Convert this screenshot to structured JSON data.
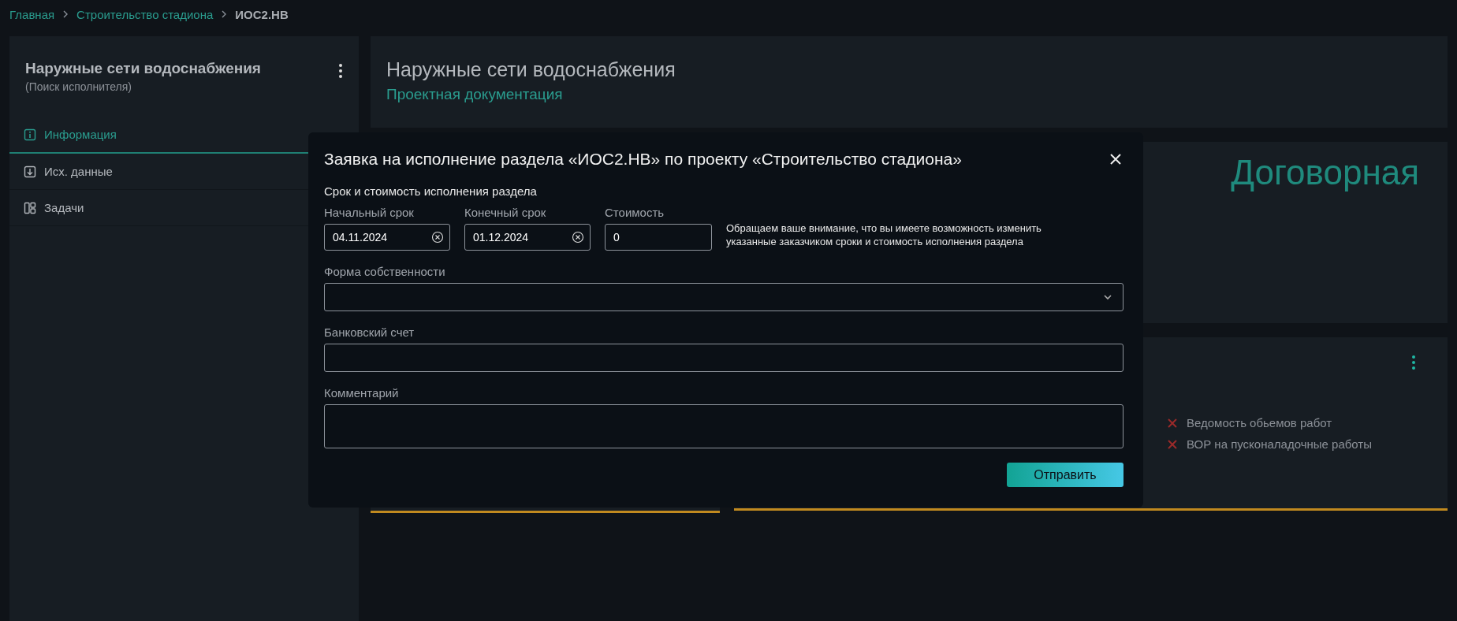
{
  "breadcrumbs": [
    {
      "label": "Главная",
      "kind": "link"
    },
    {
      "label": "Строительство стадиона",
      "kind": "link"
    },
    {
      "label": "ИОС2.НВ",
      "kind": "current"
    }
  ],
  "sidebar": {
    "title": "Наружные сети водоснабжения",
    "subtitle": "(Поиск исполнителя)",
    "tabs": [
      {
        "label": "Информация",
        "selected": true
      },
      {
        "label": "Исх. данные",
        "selected": false
      },
      {
        "label": "Задачи",
        "selected": false
      }
    ]
  },
  "header": {
    "title": "Наружные сети водоснабжения",
    "subtitle": "Проектная документация"
  },
  "price_card": {
    "value": "Договорная"
  },
  "docs_card": {
    "items": [
      {
        "label": "Ведомость обьемов работ"
      },
      {
        "label": "ВОР на пусконаладочные работы"
      }
    ]
  },
  "modal": {
    "title": "Заявка на исполнение раздела «ИОС2.НВ» по проекту «Строительство стадиона»",
    "section": "Срок и стоимость исполнения раздела",
    "row_fields": [
      {
        "label": "Начальный срок",
        "value": "04.11.2024",
        "kind": "date"
      },
      {
        "label": "Конечный срок",
        "value": "01.12.2024",
        "kind": "date"
      },
      {
        "label": "Стоимость",
        "value": "0",
        "kind": "text"
      }
    ],
    "note": "Обращаем ваше внимание, что вы имеете возможность изменить указанные заказчиком сроки и стоимость исполнения раздела",
    "fields": [
      {
        "label": "Форма собственности",
        "kind": "select"
      },
      {
        "label": "Банковский счет",
        "kind": "text"
      },
      {
        "label": "Комментарий",
        "kind": "textarea"
      }
    ],
    "submit": "Отправить"
  }
}
